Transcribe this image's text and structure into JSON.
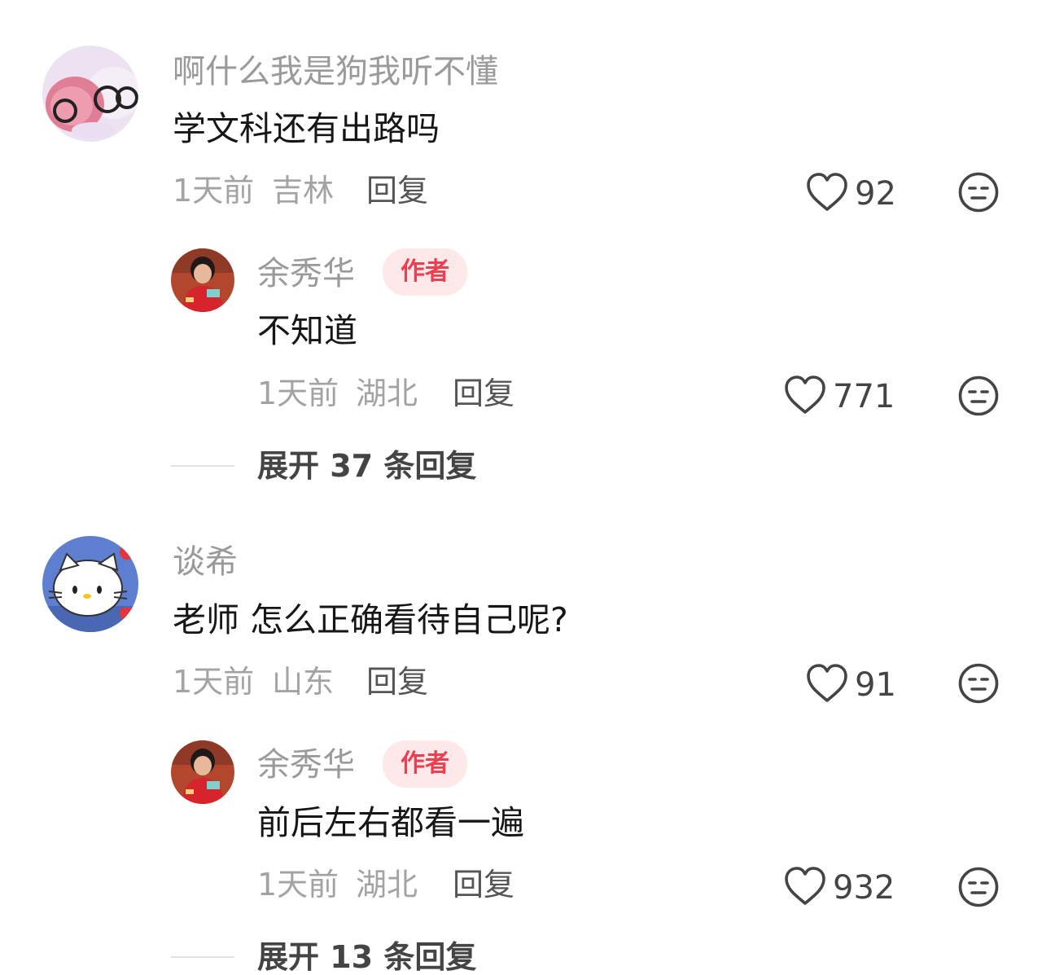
{
  "comments": [
    {
      "username": "啊什么我是狗我听不懂",
      "avatar": "pig-plush-avatar",
      "text": "学文科还有出路吗",
      "time": "1天前",
      "location": "吉林",
      "reply_label": "回复",
      "likes": "92",
      "author_reply": {
        "username": "余秀华",
        "badge": "作者",
        "avatar": "author-avatar",
        "text": "不知道",
        "time": "1天前",
        "location": "湖北",
        "reply_label": "回复",
        "likes": "771"
      },
      "expand_label": "展开 37 条回复"
    },
    {
      "username": "谈希",
      "avatar": "hello-kitty-avatar",
      "text": "老师 怎么正确看待自己呢?",
      "time": "1天前",
      "location": "山东",
      "reply_label": "回复",
      "likes": "91",
      "author_reply": {
        "username": "余秀华",
        "badge": "作者",
        "avatar": "author-avatar",
        "text": "前后左右都看一遍",
        "time": "1天前",
        "location": "湖北",
        "reply_label": "回复",
        "likes": "932"
      },
      "expand_label": "展开 13 条回复"
    }
  ],
  "icons": {
    "like": "heart-outline-icon",
    "reaction": "neutral-face-icon"
  },
  "colors": {
    "author_badge_text": "#ee3e4f",
    "author_badge_bg": "#fde9ea",
    "username": "#9a9a9a"
  }
}
